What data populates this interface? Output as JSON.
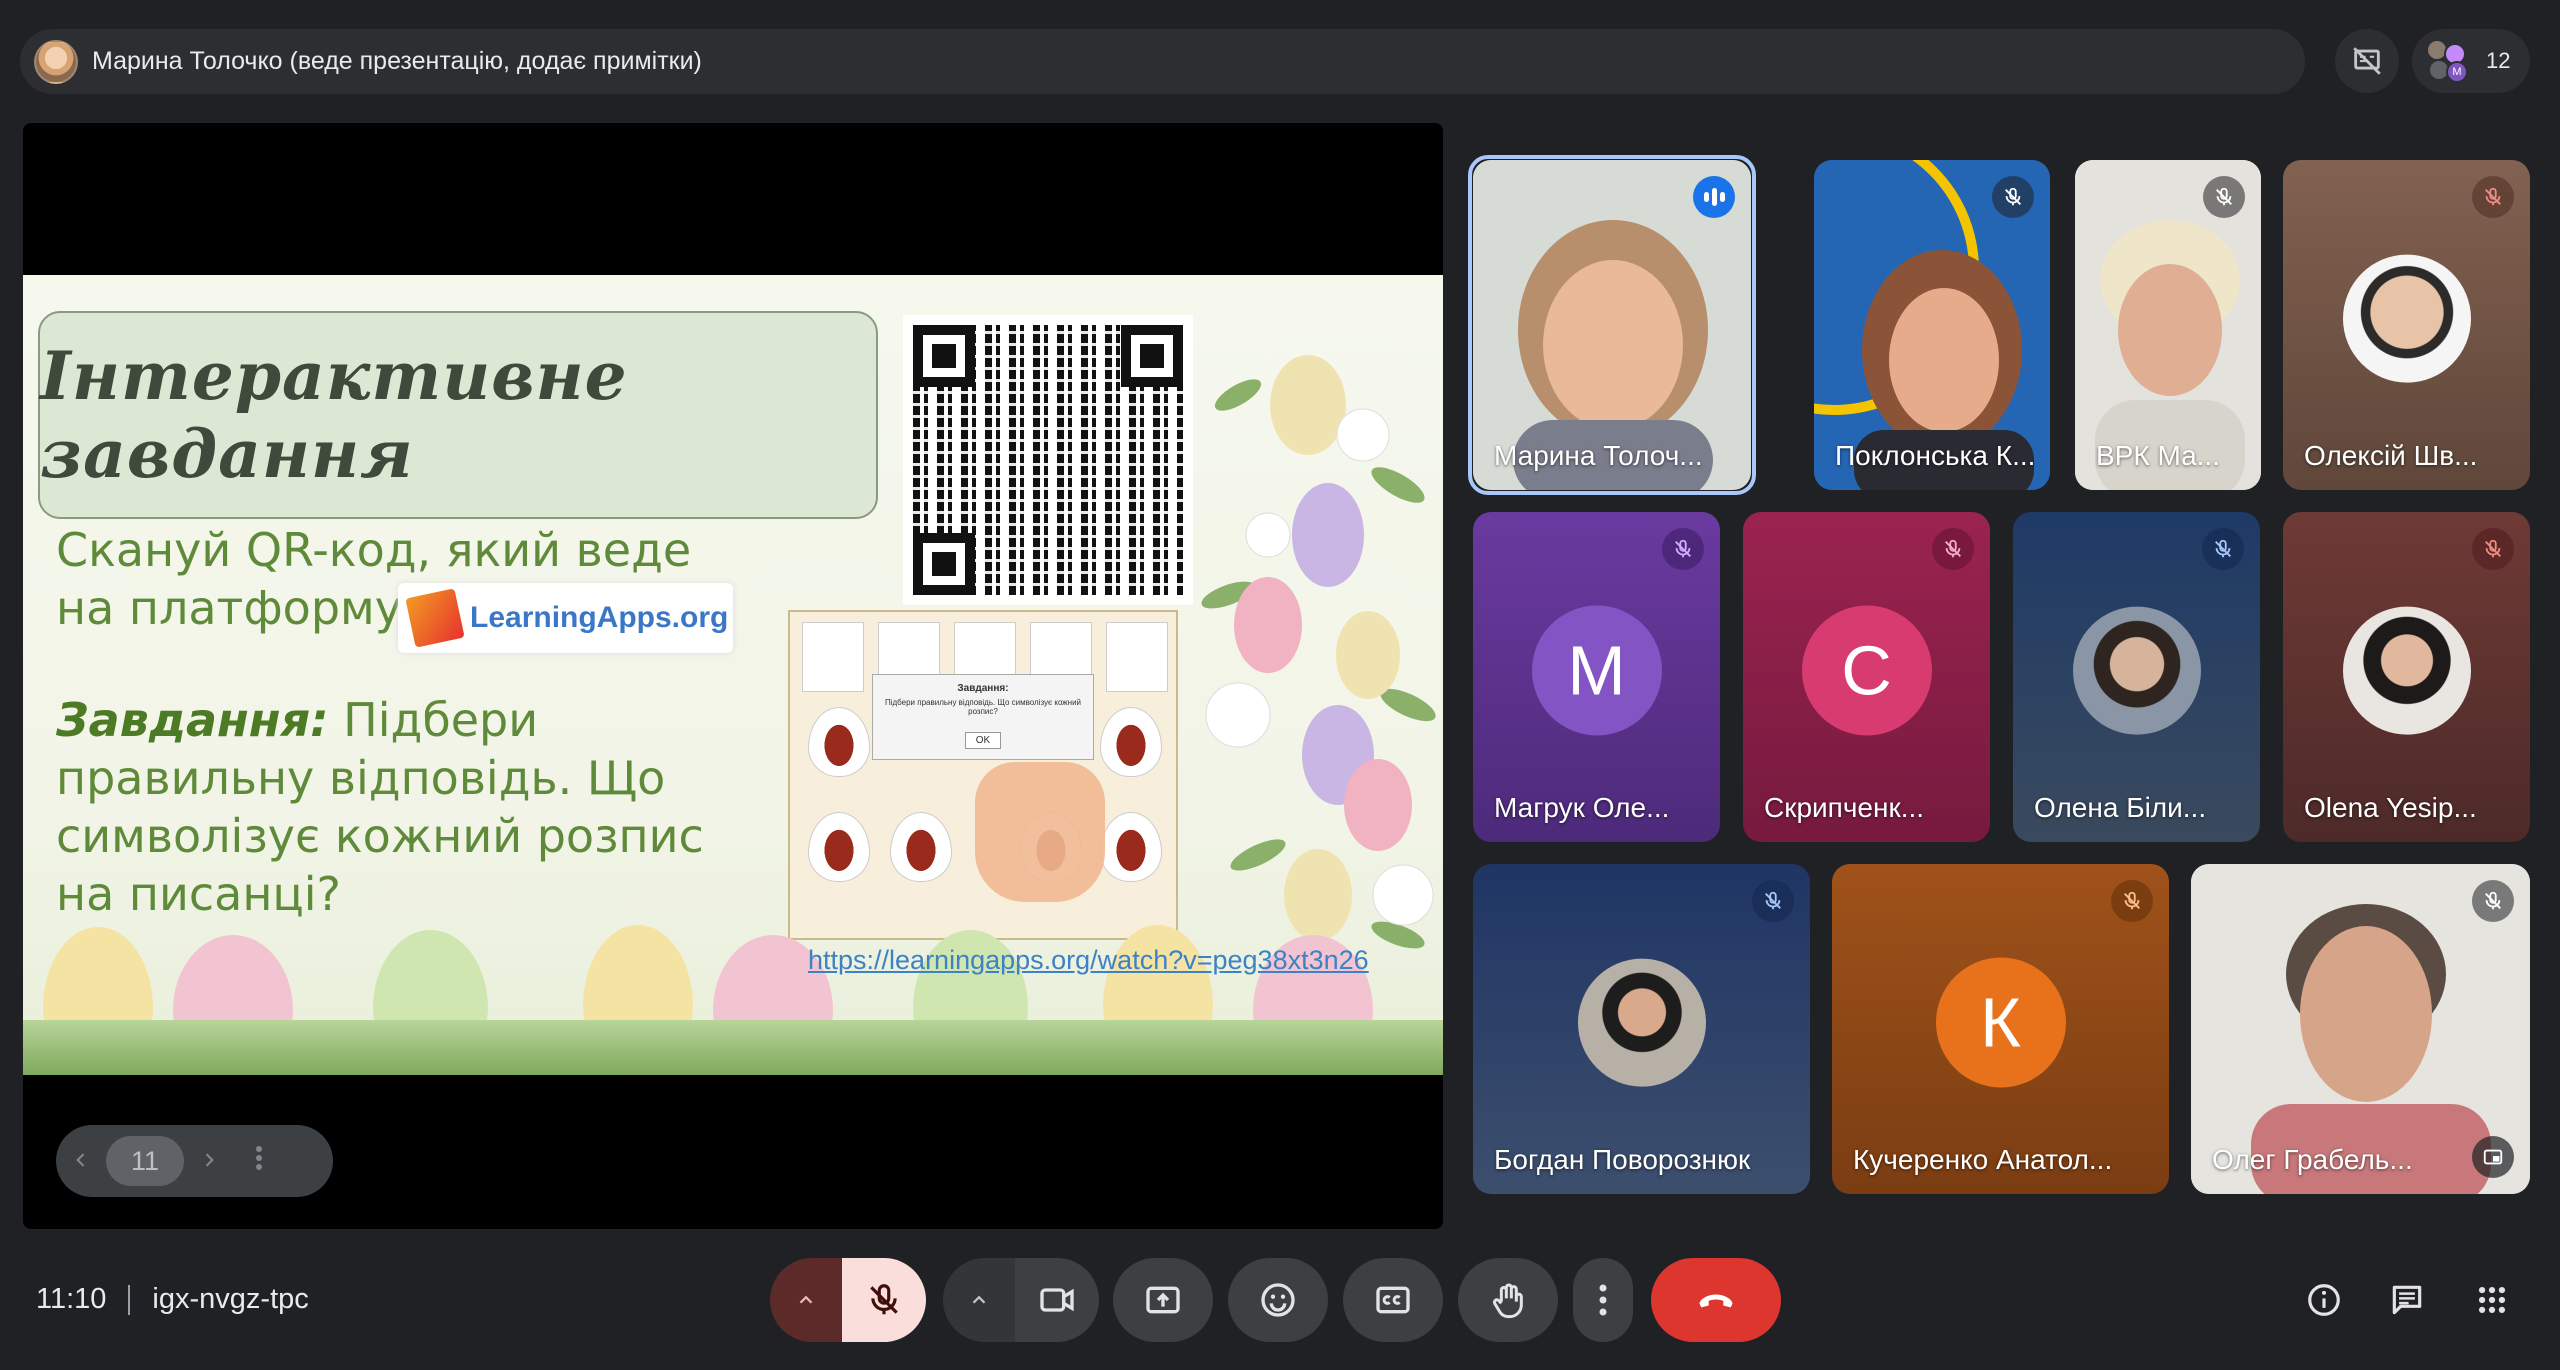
{
  "topbar": {
    "presenter_text": "Марина Толочко (веде презентацію, додає примітки)",
    "participant_count": "12",
    "participant_initial": "M"
  },
  "slide": {
    "title": "Інтерактивне завдання",
    "scan_text": "Скануй QR-код, який веде на платформу",
    "platform_badge": "LearningApps.org",
    "task_label": "Завдання:",
    "task_text": "Підбери правильну відповідь. Що символізує кожний розпис на писанці?",
    "link": "https://learningapps.org/watch?v=peg38xt3n26",
    "dialog_title": "Завдання:",
    "dialog_text": "Підбери правильну відповідь. Що символізує кожний розпис?",
    "dialog_ok": "OK"
  },
  "slide_controls": {
    "page": "11",
    "prev_icon": "chevron-left-icon",
    "next_icon": "chevron-right-icon"
  },
  "participants": [
    {
      "name": "Марина Толоч...",
      "type": "video",
      "speaking": true
    },
    {
      "name": "Поклонська К...",
      "type": "video",
      "muted": true
    },
    {
      "name": "ВРК Ма...",
      "type": "video",
      "muted": true
    },
    {
      "name": "Олексій Шв...",
      "type": "photo",
      "muted": true
    },
    {
      "name": "Магрук Оле...",
      "type": "letter",
      "letter": "M",
      "muted": true
    },
    {
      "name": "Скрипченк...",
      "type": "letter",
      "letter": "С",
      "muted": true
    },
    {
      "name": "Олена Біли...",
      "type": "photo",
      "muted": true
    },
    {
      "name": "Olena Yesip...",
      "type": "photo",
      "muted": true
    },
    {
      "name": "Богдан Поворознюк",
      "type": "photo",
      "muted": true
    },
    {
      "name": "Кучеренко Анатол...",
      "type": "letter",
      "letter": "К",
      "muted": true
    },
    {
      "name": "Олег Грабель...",
      "type": "video",
      "muted": true
    }
  ],
  "bottom": {
    "time": "11:10",
    "meeting_code": "igx-nvgz-tpc"
  },
  "colors": {
    "background": "#202124",
    "control_bg": "#3c4043",
    "mic_off_red": "#f9dedc",
    "hangup_red": "#dc362e",
    "speaking_blue": "#1a73e8"
  }
}
